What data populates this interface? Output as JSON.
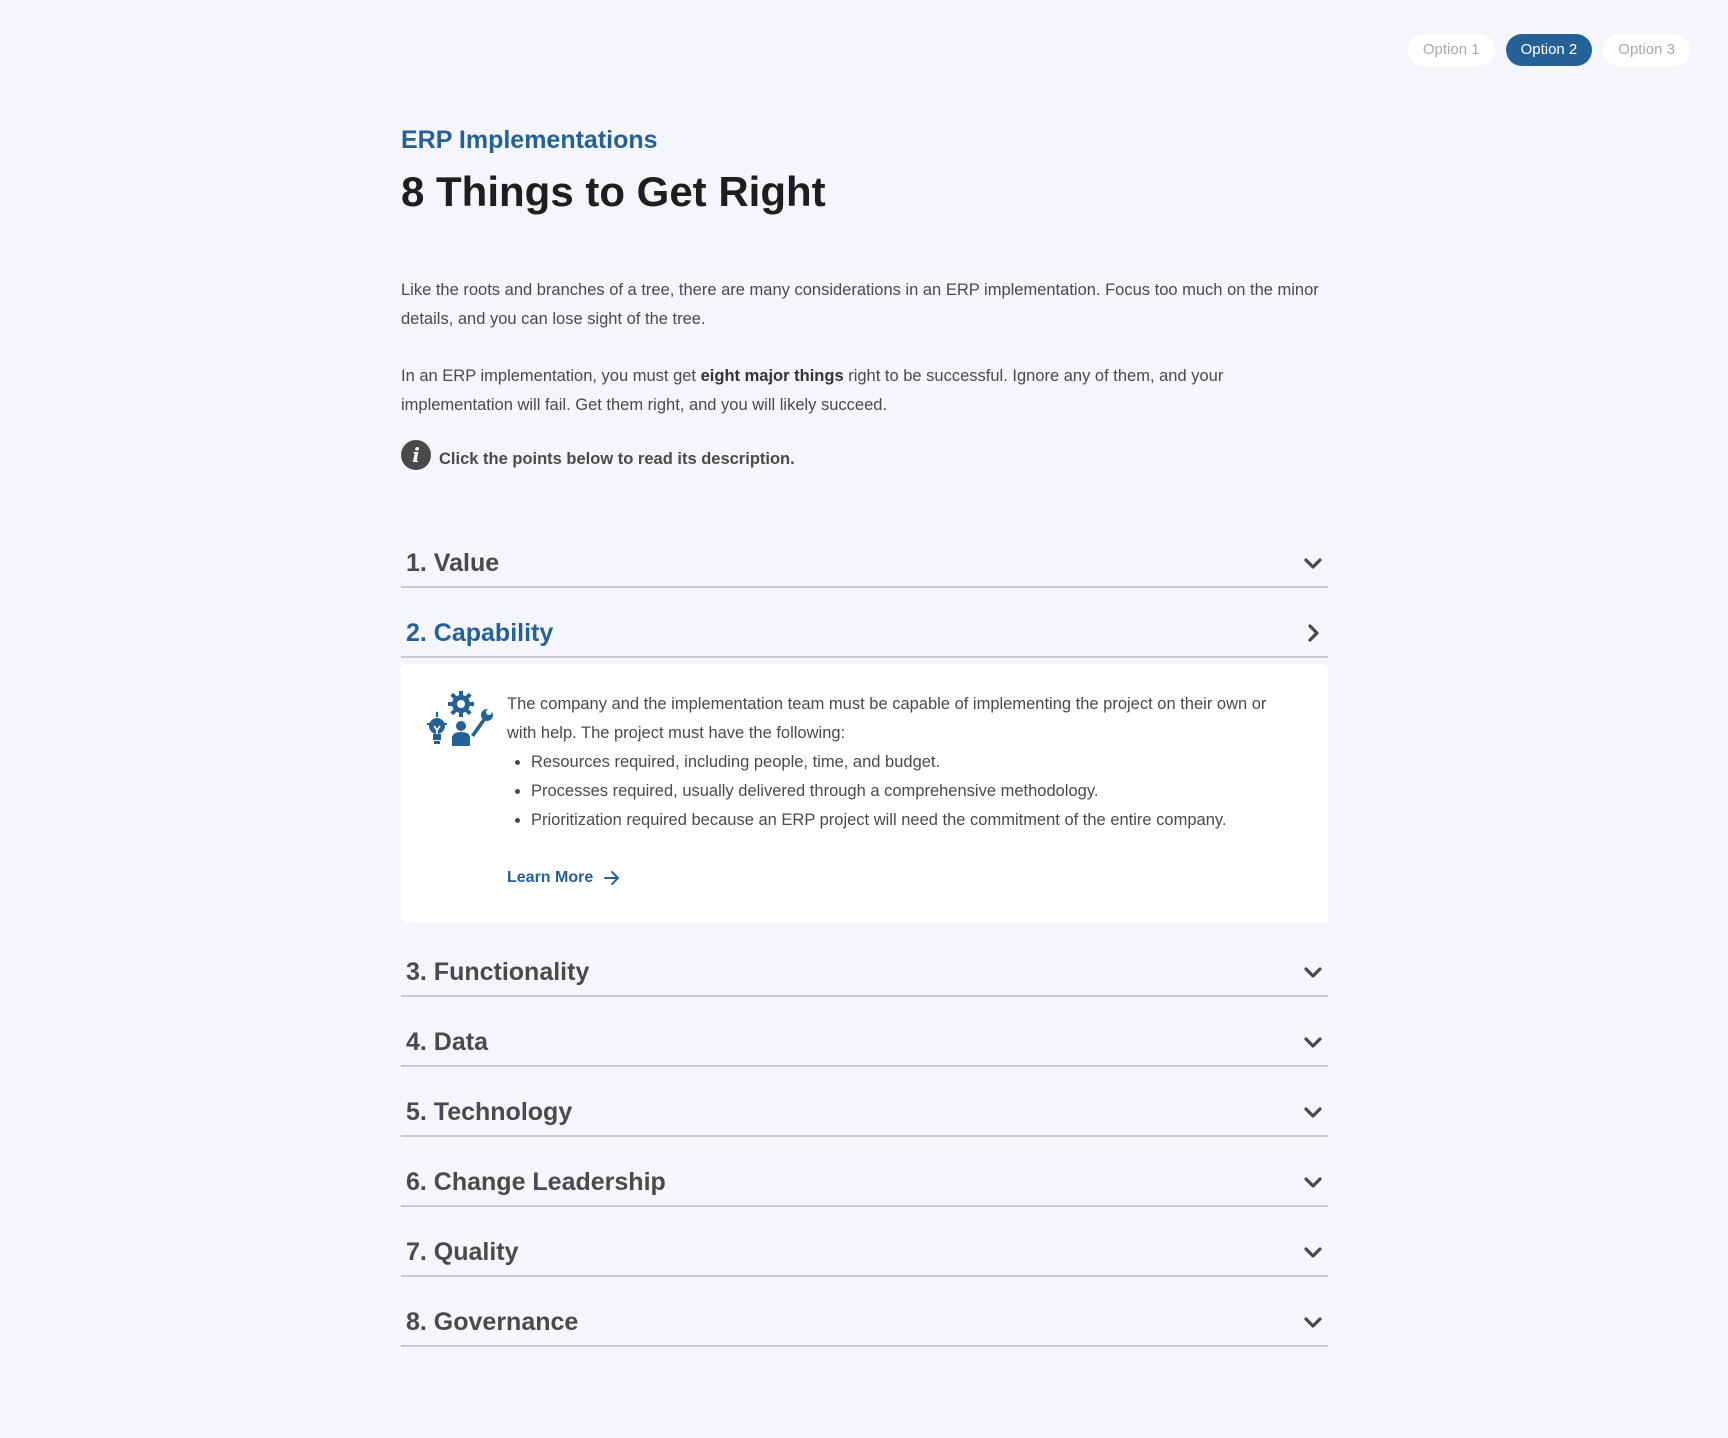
{
  "options": [
    {
      "label": "Option 1",
      "active": false
    },
    {
      "label": "Option 2",
      "active": true
    },
    {
      "label": "Option 3",
      "active": false
    }
  ],
  "header": {
    "eyebrow": "ERP Implementations",
    "title": "8 Things to Get Right"
  },
  "intro": {
    "p1": "Like the roots and branches of a tree, there are many considerations in an ERP implementation. Focus too much on the minor details, and you can lose sight of the tree.",
    "p2_before": "In an ERP implementation, you must get ",
    "p2_bold": "eight major things",
    "p2_after": " right to be successful. Ignore any of them, and your implementation will fail. Get them right, and you will likely succeed."
  },
  "hint": {
    "icon": "info-icon",
    "text": "Click the points below to read its description."
  },
  "accordion": {
    "items": [
      {
        "title": "1. Value",
        "open": false
      },
      {
        "title": "2. Capability",
        "open": true
      },
      {
        "title": "3. Functionality",
        "open": false
      },
      {
        "title": "4. Data",
        "open": false
      },
      {
        "title": "5. Technology",
        "open": false
      },
      {
        "title": "6. Change Leadership",
        "open": false
      },
      {
        "title": "7. Quality",
        "open": false
      },
      {
        "title": "8. Governance",
        "open": false
      }
    ],
    "open_panel": {
      "icon": "team-capability-icon",
      "text": "The company and the implementation team must be capable of implementing the project on their own or with help. The project must have the following:",
      "bullets": [
        "Resources required, including people, time, and budget.",
        "Processes required, usually delivered through a comprehensive methodology.",
        "Prioritization required because an ERP project will need the commitment of the entire company."
      ],
      "link_label": "Learn More"
    }
  },
  "colors": {
    "accent": "#256196",
    "background": "#f5f5fc",
    "text": "#4a4a4a"
  }
}
